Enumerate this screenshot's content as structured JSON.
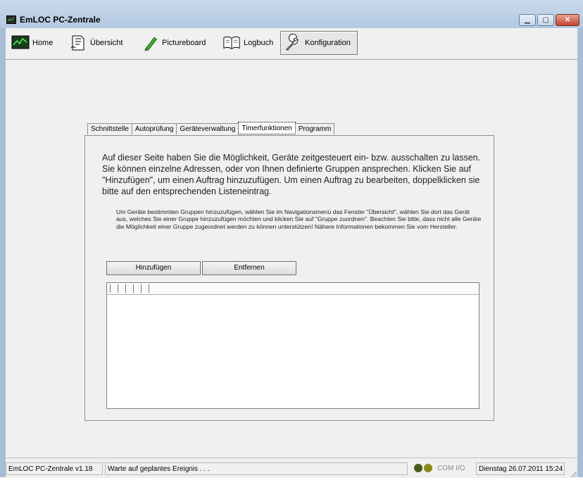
{
  "window": {
    "title": "EmLOC PC-Zentrale"
  },
  "toolbar": {
    "buttons": [
      {
        "label": "Home",
        "icon": "monitor-chart-icon"
      },
      {
        "label": "Übersicht",
        "icon": "document-outline-icon"
      },
      {
        "label": "Pictureboard",
        "icon": "highlighter-icon"
      },
      {
        "label": "Logbuch",
        "icon": "book-icon"
      },
      {
        "label": "Konfiguration",
        "icon": "wrench-icon"
      }
    ]
  },
  "tabs": [
    "Schnittstelle",
    "Autoprüfung",
    "Geräteverwaltung",
    "Timerfunktionen",
    "Programm"
  ],
  "panel": {
    "intro": "Auf dieser Seite haben Sie die Möglichkeit, Geräte zeitgesteuert ein- bzw. ausschalten zu lassen. Sie können einzelne Adressen, oder von Ihnen definierte Gruppen ansprechen. Klicken Sie auf \"Hinzufügen\", um einen Auftrag hinzuzufügen. Um einen Auftrag zu bearbeiten, doppelklicken sie bitte auf den entsprechenden Listeneintrag.",
    "note": "Um Geräte bestimmten Gruppen hinzuzufügen, wählen Sie im Navigationsmenü das Fenster \"Übersicht\", wählen Sie dort das Gerät aus, welches Sie einer Gruppe hinzuzufügen möchten und klicken Sie auf \"Gruppe zuordnen\". Beachten Sie bitte, dass nicht alle Geräte die Möglichkeit einer Gruppe zugeordnet werden zu können unterstützen! Nähere Informationen bekommen Sie vom Hersteller.",
    "add_label": "Hinzufügen",
    "remove_label": "Entfernen"
  },
  "status": {
    "version": "EmLOC PC-Zentrale v1.18",
    "message": "Warte auf geplantes Ereignis . . .",
    "com": "COM I/O",
    "datetime": "Dienstag 26.07.2011 15:24"
  },
  "colors": {
    "led1": "#4a5a12",
    "led2": "#8a8a10"
  }
}
